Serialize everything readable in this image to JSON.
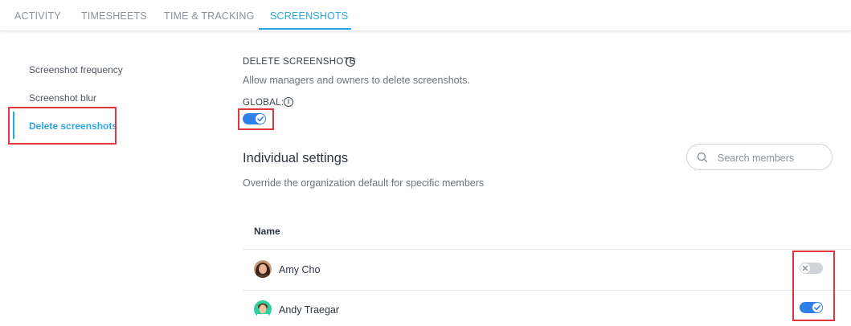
{
  "tabs": [
    {
      "label": "ACTIVITY"
    },
    {
      "label": "TIMESHEETS"
    },
    {
      "label": "TIME & TRACKING"
    },
    {
      "label": "SCREENSHOTS"
    }
  ],
  "active_tab": "SCREENSHOTS",
  "sidebar": {
    "items": [
      {
        "label": "Screenshot frequency"
      },
      {
        "label": "Screenshot blur"
      },
      {
        "label": "Delete screenshots"
      }
    ],
    "active": "Delete screenshots"
  },
  "setting": {
    "title": "DELETE SCREENSHOTS",
    "description": "Allow managers and owners to delete screenshots.",
    "global_label": "GLOBAL:",
    "global_enabled": true
  },
  "individual": {
    "title": "Individual settings",
    "description": "Override the organization default for specific members",
    "search_placeholder": "Search members",
    "column_name": "Name",
    "members": [
      {
        "name": "Amy Cho",
        "enabled": false
      },
      {
        "name": "Andy Traegar",
        "enabled": true
      }
    ]
  },
  "colors": {
    "accent": "#2aa7e0",
    "toggle_on": "#2f80e8",
    "toggle_off": "#d0d4d9",
    "highlight": "#e2363f"
  },
  "icons": [
    "info-icon",
    "search-icon",
    "check-icon",
    "x-icon"
  ]
}
